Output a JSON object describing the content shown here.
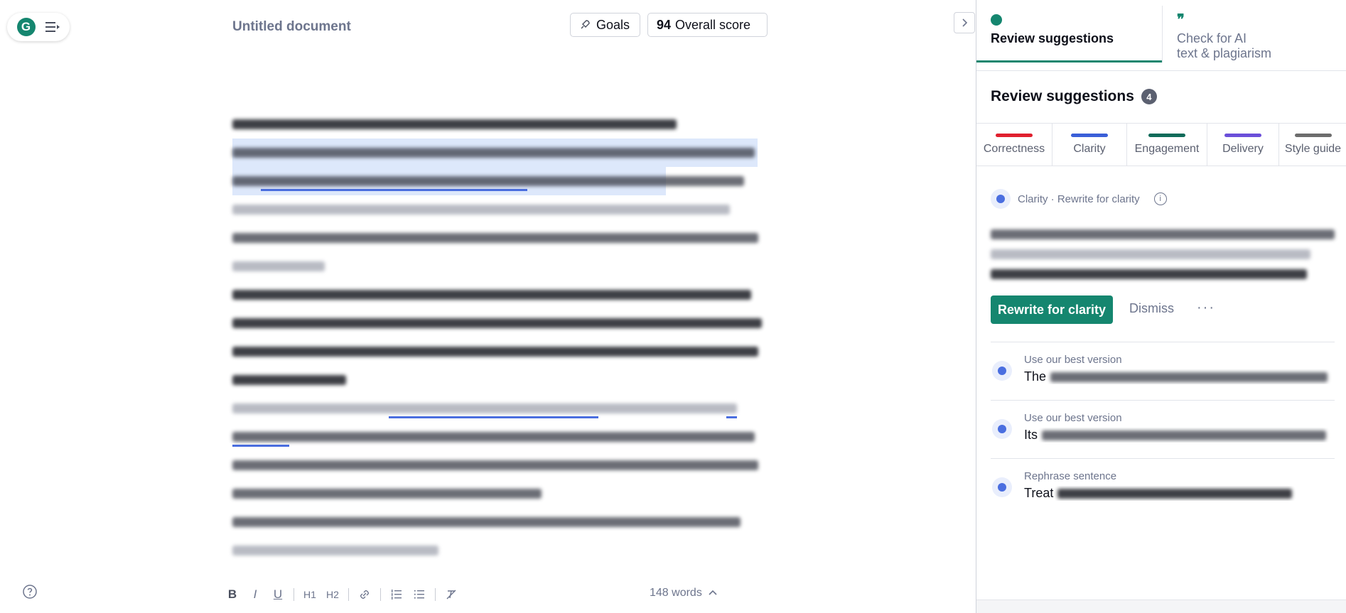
{
  "app": {
    "logo_letter": "G"
  },
  "document": {
    "title": "Untitled document",
    "goals_label": "Goals",
    "score_value": "94",
    "score_label": "Overall score",
    "word_count": "148 words"
  },
  "toolbar": {
    "bold": "B",
    "italic": "I",
    "underline": "U",
    "h1": "H1",
    "h2": "H2"
  },
  "panel": {
    "tab_review": "Review suggestions",
    "tab_ai_line1": "Check for AI",
    "tab_ai_line2": "text & plagiarism",
    "heading": "Review suggestions",
    "count": "4",
    "categories": [
      {
        "label": "Correctness",
        "color": "#e0202e"
      },
      {
        "label": "Clarity",
        "color": "#3a5fd8"
      },
      {
        "label": "Engagement",
        "color": "#0f6b59"
      },
      {
        "label": "Delivery",
        "color": "#6b4fd9"
      },
      {
        "label": "Style guide",
        "color": "#6d6d6d"
      }
    ],
    "card": {
      "meta": "Clarity · Rewrite for clarity",
      "rewrite_label": "Rewrite for clarity",
      "dismiss_label": "Dismiss",
      "more_label": "···"
    },
    "alternatives": [
      {
        "label": "Use our best version",
        "text_start": "The"
      },
      {
        "label": "Use our best version",
        "text_start": "Its"
      },
      {
        "label": "Rephrase sentence",
        "text_start": "Treat"
      }
    ]
  }
}
